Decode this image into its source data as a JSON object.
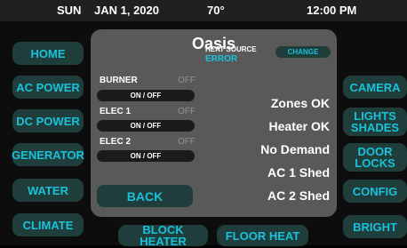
{
  "status_bar": {
    "day": "SUN",
    "date": "JAN 1, 2020",
    "temperature": "70°",
    "time": "12:00 PM"
  },
  "left_nav": [
    "HOME",
    "AC POWER",
    "DC POWER",
    "GENERATOR",
    "WATER",
    "CLIMATE"
  ],
  "right_nav": [
    "CAMERA",
    "LIGHTS SHADES",
    "DOOR LOCKS",
    "CONFIG",
    "BRIGHT"
  ],
  "bottom_nav": [
    "BLOCK HEATER",
    "FLOOR HEAT"
  ],
  "panel": {
    "title": "Oasis",
    "controls": [
      {
        "label": "BURNER",
        "state": "OFF",
        "toggle": "ON / OFF"
      },
      {
        "label": "ELEC 1",
        "state": "OFF",
        "toggle": "ON / OFF"
      },
      {
        "label": "ELEC 2",
        "state": "OFF",
        "toggle": "ON / OFF"
      }
    ],
    "heat_source_label": "HEAT SOURCE",
    "heat_source_value": "ERROR",
    "change_label": "CHANGE",
    "statuses": [
      "Zones OK",
      "Heater OK",
      "No Demand",
      "AC 1 Shed",
      "AC 2 Shed"
    ],
    "back_label": "BACK"
  },
  "colors": {
    "accent": "#19c2da",
    "button_bg": "#1f3d3a",
    "panel_bg": "#595959"
  }
}
